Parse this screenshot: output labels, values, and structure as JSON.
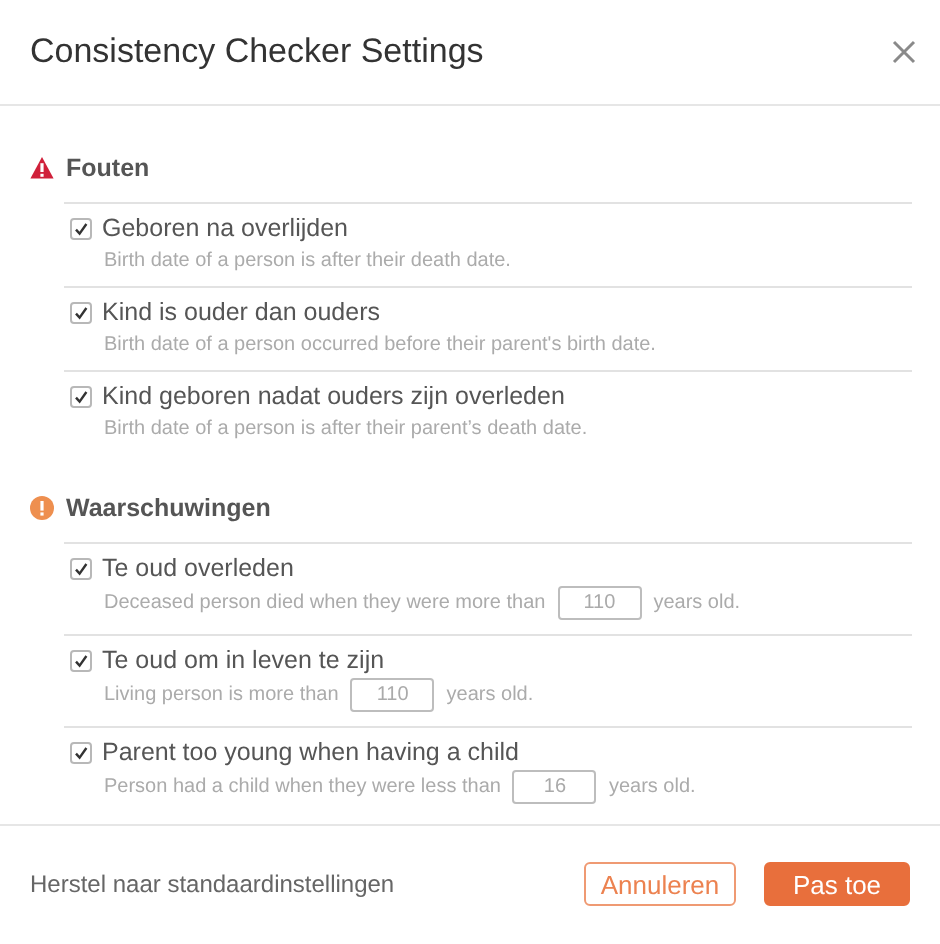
{
  "dialog": {
    "title": "Consistency Checker Settings"
  },
  "sections": [
    {
      "title": "Fouten",
      "kind": "error",
      "rules": [
        {
          "label": "Geboren na overlijden",
          "checked": true,
          "kind": "plain",
          "description": "Birth date of a person is after their death date."
        },
        {
          "label": "Kind is ouder dan ouders",
          "checked": true,
          "kind": "plain",
          "description": "Birth date of a person occurred before their parent's birth date."
        },
        {
          "label": "Kind geboren nadat ouders zijn overleden",
          "checked": true,
          "kind": "plain",
          "description": "Birth date of a person is after their parent’s death date."
        }
      ]
    },
    {
      "title": "Waarschuwingen",
      "kind": "warning",
      "rules": [
        {
          "label": "Te oud overleden",
          "checked": true,
          "kind": "threshold",
          "description": "Deceased person died when they were more than",
          "value": "110",
          "suffix": "years old."
        },
        {
          "label": "Te oud om in leven te zijn",
          "checked": true,
          "kind": "threshold",
          "description": "Living person is more than",
          "value": "110",
          "suffix": "years old."
        },
        {
          "label": "Parent too young when having a child",
          "checked": true,
          "kind": "threshold",
          "description": "Person had a child when they were less than",
          "value": "16",
          "suffix": "years old."
        }
      ]
    }
  ],
  "footer": {
    "reset_link": "Herstel naar standaardinstellingen",
    "cancel_button": "Annuleren",
    "apply_button": "Pas toe"
  }
}
